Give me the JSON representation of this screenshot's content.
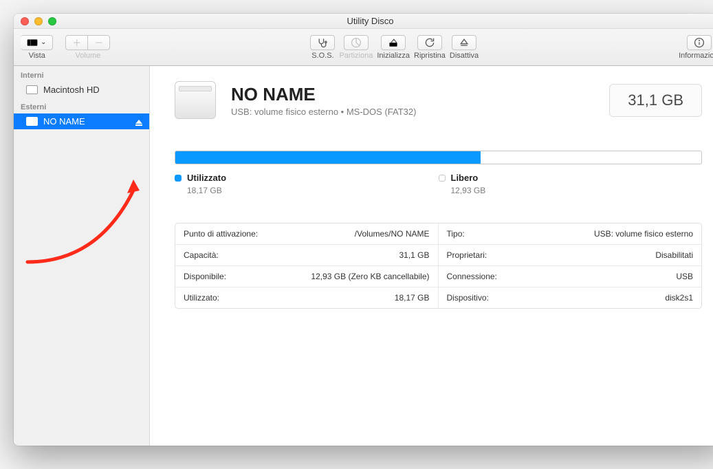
{
  "window": {
    "title": "Utility Disco"
  },
  "toolbar": {
    "vista": "Vista",
    "volume": "Volume",
    "sos": "S.O.S.",
    "partition": "Partiziona",
    "erase": "Inizializza",
    "restore": "Ripristina",
    "unmount": "Disattiva",
    "info": "Informazioni"
  },
  "sidebar": {
    "internal_header": "Interni",
    "internal": {
      "name": "Macintosh HD"
    },
    "external_header": "Esterni",
    "external": {
      "name": "NO NAME"
    }
  },
  "volume": {
    "name": "NO NAME",
    "subtitle": "USB: volume fisico esterno • MS-DOS (FAT32)",
    "capacity_display": "31,1 GB",
    "used_pct": 58,
    "legend": {
      "used_label": "Utilizzato",
      "used_value": "18,17 GB",
      "free_label": "Libero",
      "free_value": "12,93 GB"
    },
    "info": [
      {
        "k": "Punto di attivazione:",
        "v": "/Volumes/NO NAME"
      },
      {
        "k": "Tipo:",
        "v": "USB: volume fisico esterno"
      },
      {
        "k": "Capacità:",
        "v": "31,1 GB"
      },
      {
        "k": "Proprietari:",
        "v": "Disabilitati"
      },
      {
        "k": "Disponibile:",
        "v": "12,93 GB (Zero KB cancellabile)"
      },
      {
        "k": "Connessione:",
        "v": "USB"
      },
      {
        "k": "Utilizzato:",
        "v": "18,17 GB"
      },
      {
        "k": "Dispositivo:",
        "v": "disk2s1"
      }
    ]
  }
}
